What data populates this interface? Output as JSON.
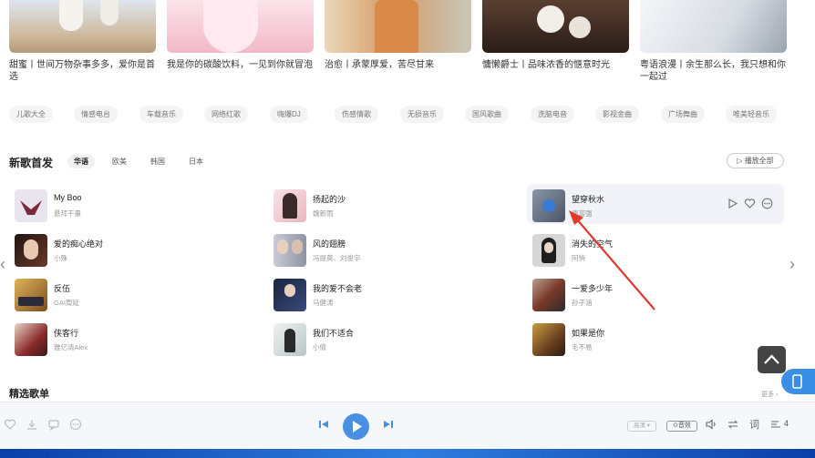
{
  "playlists": [
    {
      "title": "甜蜜丨世间万物杂事多多，爱你是首选",
      "color": "#c9b59a"
    },
    {
      "title": "我是你的碳酸饮料，一见到你就冒泡",
      "color": "#f3c7d3"
    },
    {
      "title": "治愈丨承蒙厚爱，苦尽甘来",
      "color": "#d9a67a"
    },
    {
      "title": "慵懒爵士丨品味浓香的惬意时光",
      "color": "#6b4a3a"
    },
    {
      "title": "粤语浪漫丨余生那么长，我只想和你一起过",
      "color": "#e6e9ee"
    }
  ],
  "tags": [
    "儿歌大全",
    "情感电台",
    "车载音乐",
    "网络红歌",
    "嗨爆DJ",
    "伤感情歌",
    "无损音乐",
    "国风歌曲",
    "洗脑电音",
    "影视金曲",
    "广场舞曲",
    "唯美轻音乐"
  ],
  "new_songs": {
    "title": "新歌首发",
    "tabs": [
      "华语",
      "欧美",
      "韩国",
      "日本"
    ],
    "active_tab": "华语",
    "play_all": "▷ 播放全部",
    "columns": [
      [
        {
          "name": "My Boo",
          "artist": "悬拜干量",
          "color": "#e8e0ea"
        },
        {
          "name": "爱的痴心绝对",
          "artist": "小殊",
          "color": "#3a2a25"
        },
        {
          "name": "反伍",
          "artist": "GAI周延",
          "color": "#c79a4a"
        },
        {
          "name": "侠客行",
          "artist": "雅亿清Alex",
          "color": "#8a3a3a"
        }
      ],
      [
        {
          "name": "扬起的沙",
          "artist": "魏新雨",
          "color": "#f1d6d8"
        },
        {
          "name": "风的翅膀",
          "artist": "冯提莫、刘俊宇",
          "color": "#b7bac5"
        },
        {
          "name": "我的爱不会老",
          "artist": "马健涛",
          "color": "#1f2d4d"
        },
        {
          "name": "我们不适合",
          "artist": "小倩",
          "color": "#cfd8d8"
        }
      ],
      [
        {
          "name": "望穿秋水",
          "artist": "唐富强",
          "color": "#6e7a8a"
        },
        {
          "name": "消失的空气",
          "artist": "阿悄",
          "color": "#d8d8d8"
        },
        {
          "name": "一爱多少年",
          "artist": "孙子涵",
          "color": "#7a4a3a"
        },
        {
          "name": "如果是你",
          "artist": "毛不易",
          "color": "#5a4a30"
        }
      ]
    ]
  },
  "featured": {
    "title": "精选歌单",
    "more": "更多 ›"
  },
  "player": {
    "quality": "高清 ▾",
    "effect": "⊙音效",
    "playlist_count": "4",
    "accent": "#4a90e2"
  }
}
